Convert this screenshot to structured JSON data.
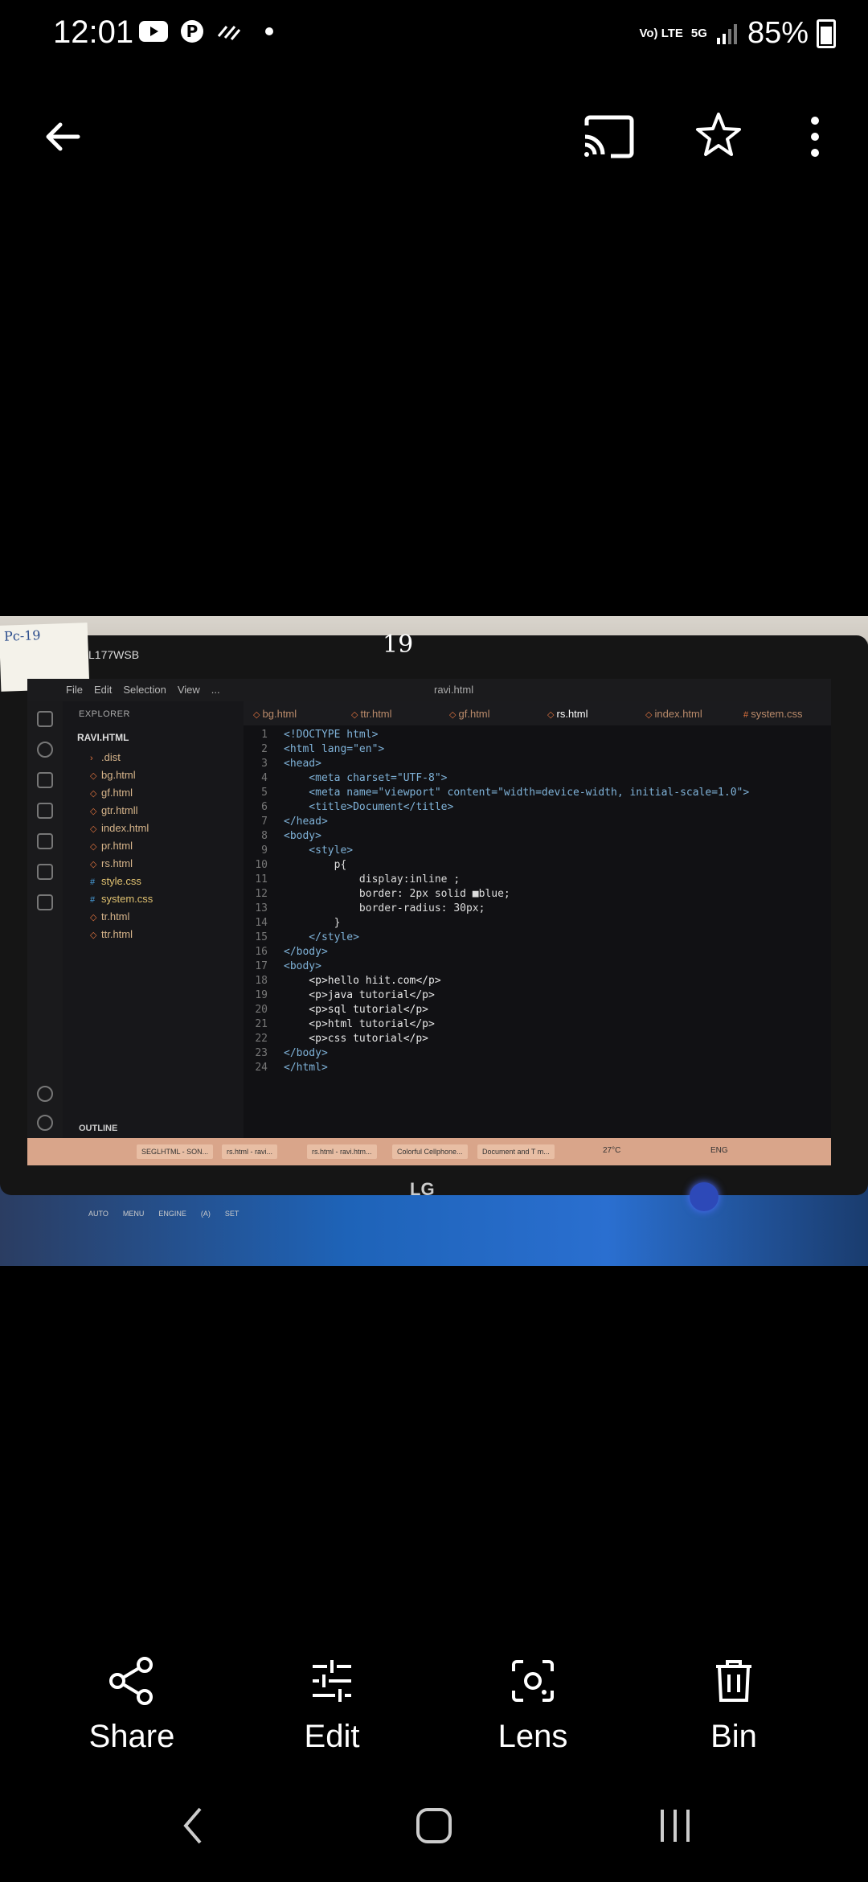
{
  "status_bar": {
    "time": "12:01",
    "left_icons": [
      "youtube-icon",
      "pinterest-icon",
      "data-sync-icon",
      "dot-icon"
    ],
    "network": "Vo) LTE",
    "network_type": "5G",
    "battery": "85%"
  },
  "top_bar": {
    "back_icon": "arrow-left-icon",
    "cast_icon": "cast-icon",
    "star_icon": "star-icon",
    "more_icon": "more-vertical-icon"
  },
  "photo": {
    "sticky_note": "Pc-19",
    "handwritten_number": "19",
    "monitor_model": "L177WSB",
    "monitor_brand": "LG",
    "monitor_buttons": [
      "AUTO",
      "MENU",
      "ENGINE",
      "(A)",
      "SET"
    ],
    "vscode": {
      "menu": [
        "File",
        "Edit",
        "Selection",
        "View",
        "..."
      ],
      "search": "ravi.html",
      "explorer_header": "EXPLORER",
      "folder": "RAVI.HTML",
      "files": [
        {
          "name": ".dist",
          "type": "folder"
        },
        {
          "name": "bg.html",
          "type": "html"
        },
        {
          "name": "gf.html",
          "type": "html"
        },
        {
          "name": "gtr.htmll",
          "type": "html"
        },
        {
          "name": "index.html",
          "type": "html"
        },
        {
          "name": "pr.html",
          "type": "html"
        },
        {
          "name": "rs.html",
          "type": "html"
        },
        {
          "name": "style.css",
          "type": "css"
        },
        {
          "name": "system.css",
          "type": "css"
        },
        {
          "name": "tr.html",
          "type": "html"
        },
        {
          "name": "ttr.html",
          "type": "html"
        }
      ],
      "outline": "OUTLINE",
      "tabs": [
        "bg.html",
        "ttr.html",
        "gf.html",
        "rs.html",
        "index.html",
        "system.css"
      ],
      "active_tab": "rs.html",
      "code_lines": [
        "<!DOCTYPE html>",
        "<html lang=\"en\">",
        "<head>",
        "    <meta charset=\"UTF-8\">",
        "    <meta name=\"viewport\" content=\"width=device-width, initial-scale=1.0\">",
        "    <title>Document</title>",
        "</head>",
        "<body>",
        "    <style>",
        "        p{",
        "            display:inline ;",
        "            border: 2px solid ■blue;",
        "            border-radius: 30px;",
        "        }",
        "    </style>",
        "</body>",
        "<body>",
        "    <p>hello hiit.com</p>",
        "    <p>java tutorial</p>",
        "    <p>sql tutorial</p>",
        "    <p>html tutorial</p>",
        "    <p>css tutorial</p>",
        "</body>",
        "</html>"
      ],
      "taskbar_items": [
        "SEGLHTML - SON...",
        "rs.html - ravi...",
        "rs.html - ravi.htm...",
        "Colorful Cellphone...",
        "Document and T m..."
      ],
      "taskbar_weather": "27°C",
      "taskbar_lang": "ENG"
    }
  },
  "actions": [
    {
      "label": "Share",
      "icon": "share-icon"
    },
    {
      "label": "Edit",
      "icon": "sliders-icon"
    },
    {
      "label": "Lens",
      "icon": "lens-icon"
    },
    {
      "label": "Bin",
      "icon": "trash-icon"
    }
  ],
  "nav_bar": {
    "back": "nav-back-icon",
    "home": "nav-home-icon",
    "recents": "nav-recents-icon"
  }
}
